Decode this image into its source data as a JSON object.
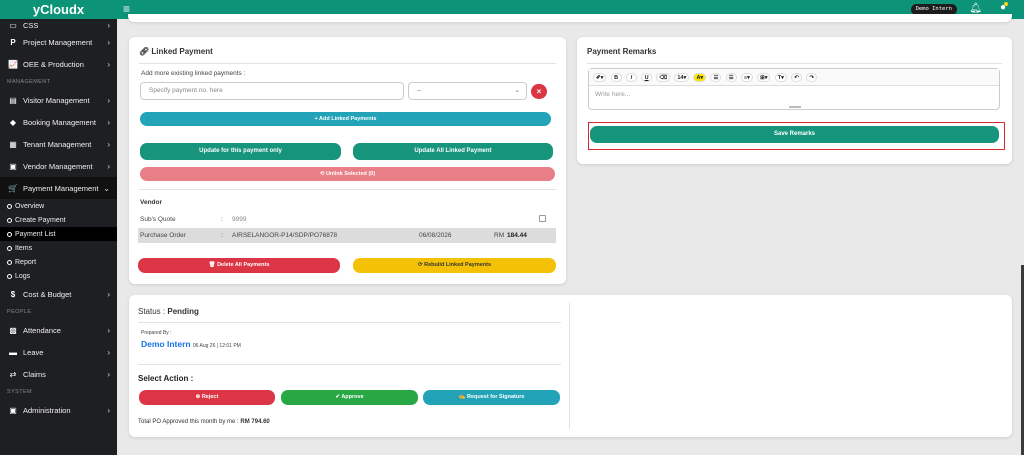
{
  "app": {
    "brand": "yCloudx"
  },
  "topbar": {
    "menu_icon": "hamburger-icon",
    "user_chip": "Demo Intern"
  },
  "sidebar": {
    "items_top": [
      {
        "label": "CSS",
        "icon": "square-icon"
      },
      {
        "label": "Project Management",
        "icon": "p-icon"
      },
      {
        "label": "OEE & Production",
        "icon": "chart-line-icon"
      }
    ],
    "section_management": "MANAGEMENT",
    "items_management": [
      {
        "label": "Visitor Management",
        "icon": "id-card-icon"
      },
      {
        "label": "Booking Management",
        "icon": "diamond-icon"
      },
      {
        "label": "Tenant Management",
        "icon": "building-icon"
      },
      {
        "label": "Vendor Management",
        "icon": "vendor-icon"
      },
      {
        "label": "Payment Management",
        "icon": "cart-icon"
      }
    ],
    "payment_subitems": [
      "Overview",
      "Create Payment",
      "Payment List",
      "Items",
      "Report",
      "Logs"
    ],
    "item_cost": {
      "label": "Cost & Budget",
      "icon": "dollar-icon"
    },
    "section_people": "PEOPLE",
    "items_people": [
      {
        "label": "Attendance",
        "icon": "calendar-icon"
      },
      {
        "label": "Leave",
        "icon": "suitcase-icon"
      },
      {
        "label": "Claims",
        "icon": "arrows-icon"
      }
    ],
    "section_system": "SYSTEM",
    "items_system": [
      {
        "label": "Administration",
        "icon": "admin-icon"
      }
    ]
  },
  "linked": {
    "title": "Linked Payment",
    "add_label": "Add more existing linked payments :",
    "placeholder": "Specify payment no. here",
    "select_value": "--",
    "add_btn": "Add Linked Payments",
    "update_one": "Update for this payment only",
    "update_all": "Update All Linked Payment",
    "unlink_btn": "Unlink Selected (0)",
    "vendor_label": "Vendor",
    "subs_quote_label": "Sub's Quote",
    "subs_quote_value": "9999",
    "po_label": "Purchase Order",
    "po_value": "AIRSELANGOR-P14/SDP/PO76878",
    "po_date": "06/08/2026",
    "po_currency": "RM",
    "po_amount": "184.44",
    "delete_btn": "Delete All Payments",
    "rebuild_btn": "Rebuild Linked Payments",
    "colon": ":"
  },
  "remarks": {
    "title": "Payment Remarks",
    "toolbar": [
      "✐▾",
      "B",
      "I",
      "U",
      "⌫",
      "14▾",
      "A▾",
      "☰",
      "☰",
      "≡▾",
      "⊞▾",
      "T▾",
      "↶",
      "↷"
    ],
    "editor_placeholder": "Write here...",
    "save_btn": "Save Remarks"
  },
  "status": {
    "label": "Status :",
    "value": "Pending",
    "prepared_by_label": "Prepared By :",
    "prepared_name": "Demo Intern",
    "prepared_date": "06 Aug 26 | 12:01 PM",
    "select_action": "Select Action :",
    "reject_btn": "Reject",
    "approve_btn": "Approve",
    "signature_btn": "Request for Signature",
    "total_label": "Total PO Approved this month by me :",
    "total_value": "RM 794.60"
  },
  "colors": {
    "brand": "#0d9377",
    "teal_btn": "#16947c",
    "cyan_btn": "#22a3b8",
    "pink_btn": "#e87f86",
    "red_btn": "#dc3545",
    "yellow_btn": "#f5c107",
    "green_btn": "#28a745"
  }
}
